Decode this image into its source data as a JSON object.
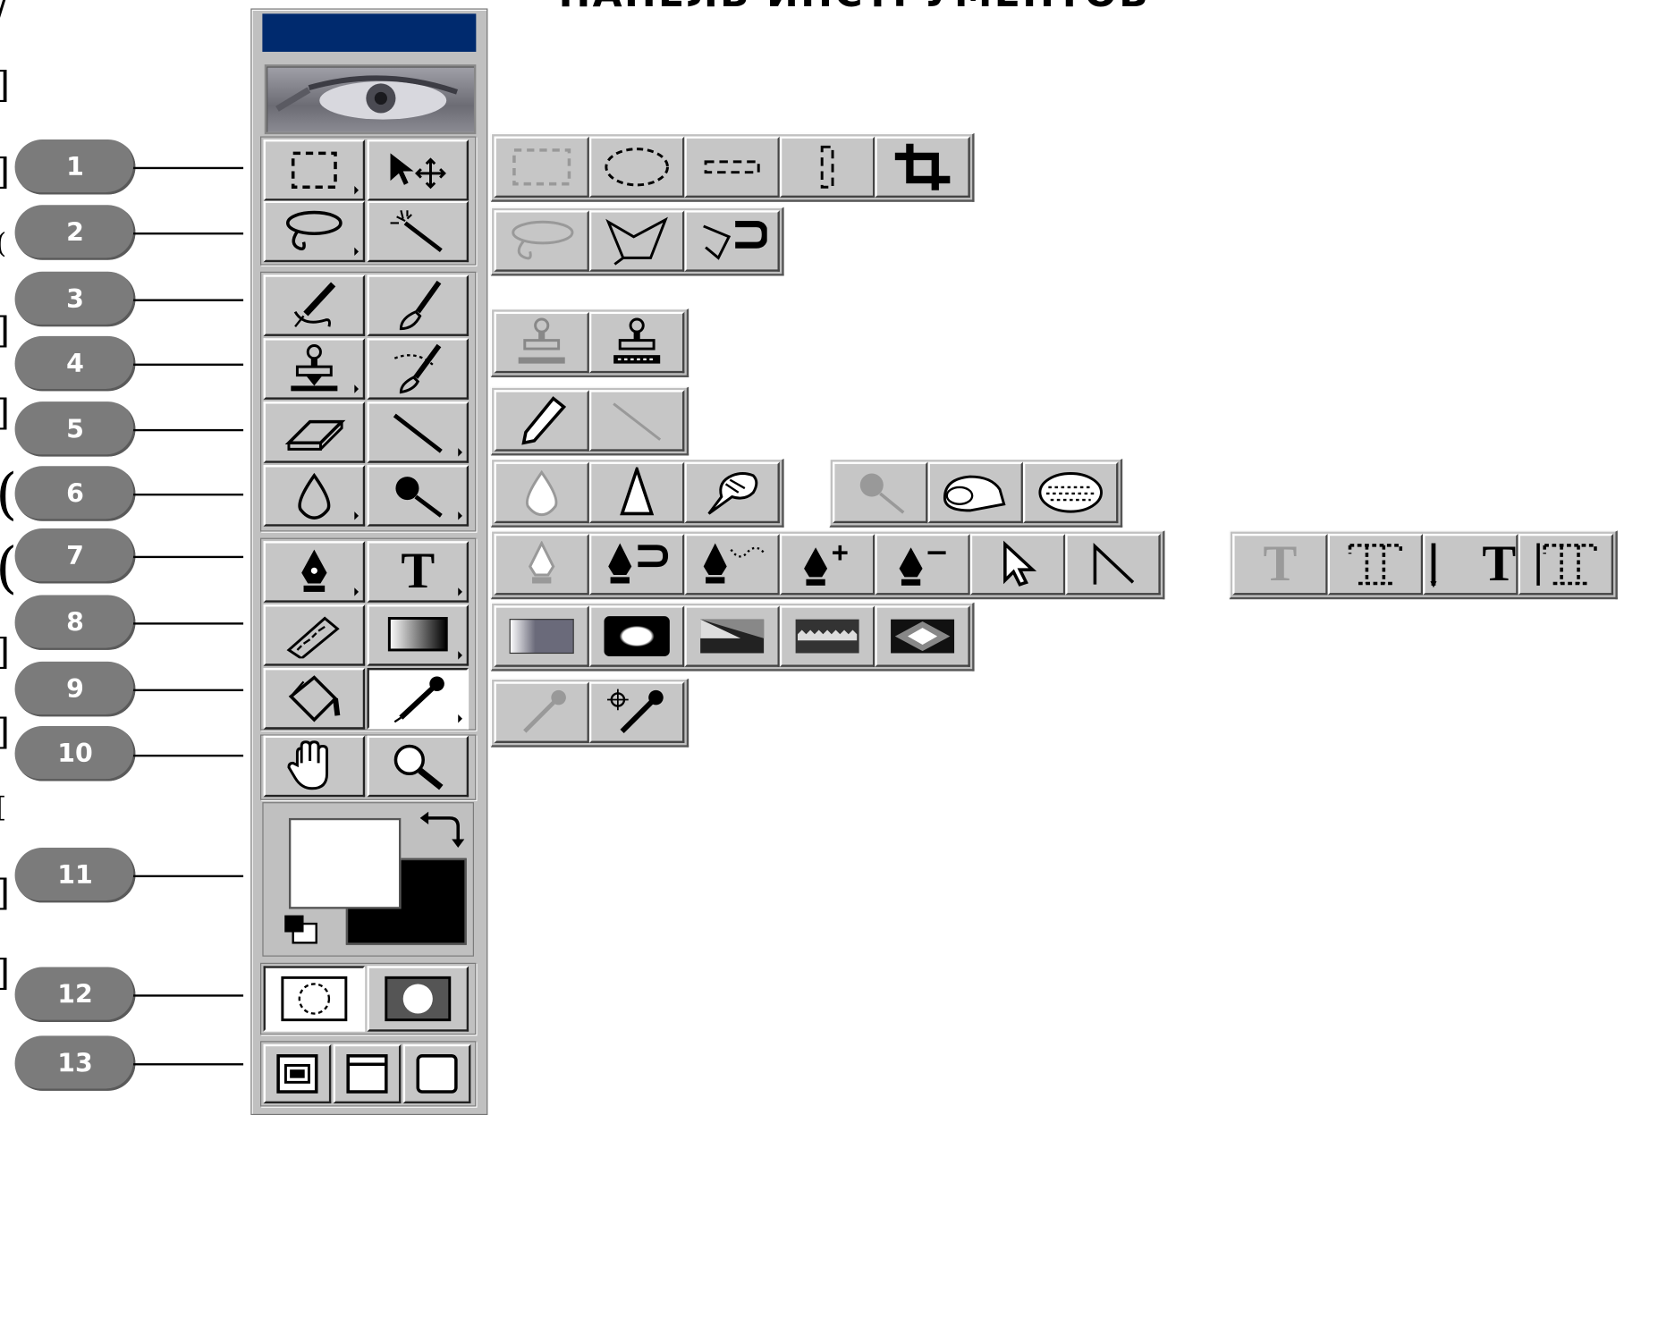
{
  "heading_fragment": "ПАНЕЛЬ ИНСТРУМЕНТОВ",
  "left_edge_glyphs": [
    "/",
    "]",
    "]",
    "(",
    "]",
    "]",
    "(",
    "(",
    "]",
    "]",
    "[",
    "]",
    "]"
  ],
  "callouts": [
    "1",
    "2",
    "3",
    "4",
    "5",
    "6",
    "7",
    "8",
    "9",
    "10",
    "11",
    "12",
    "13"
  ],
  "toolbox": {
    "tools": [
      {
        "row": 1,
        "left": "rect-marquee-icon",
        "right": "move-icon"
      },
      {
        "row": 2,
        "left": "lasso-icon",
        "right": "magic-wand-icon"
      },
      {
        "row": 3,
        "left": "airbrush-icon",
        "right": "paintbrush-icon"
      },
      {
        "row": 4,
        "left": "rubber-stamp-icon",
        "right": "history-brush-icon"
      },
      {
        "row": 5,
        "left": "eraser-icon",
        "right": "line-icon"
      },
      {
        "row": 6,
        "left": "blur-icon",
        "right": "dodge-icon"
      },
      {
        "row": 7,
        "left": "pen-icon",
        "right": "type-icon"
      },
      {
        "row": 8,
        "left": "measure-icon",
        "right": "gradient-icon"
      },
      {
        "row": 9,
        "left": "paint-bucket-icon",
        "right": "eyedropper-icon"
      },
      {
        "row": 10,
        "left": "hand-icon",
        "right": "zoom-icon"
      }
    ],
    "type_glyph": "T"
  },
  "flyouts": {
    "marquee": [
      "rect-marquee-icon",
      "ellipse-marquee-icon",
      "single-row-marquee-icon",
      "single-column-marquee-icon",
      "crop-icon"
    ],
    "lasso": [
      "lasso-icon",
      "polygon-lasso-icon",
      "magnetic-lasso-icon"
    ],
    "stamp": [
      "rubber-stamp-icon",
      "pattern-stamp-icon"
    ],
    "pencil": [
      "pencil-icon",
      "line-icon"
    ],
    "focus": [
      "blur-icon",
      "sharpen-icon",
      "smudge-icon"
    ],
    "toning": [
      "dodge-icon",
      "burn-icon",
      "sponge-icon"
    ],
    "pen": [
      "pen-icon",
      "magnetic-pen-icon",
      "freeform-pen-icon",
      "add-anchor-icon",
      "delete-anchor-icon",
      "direct-select-icon",
      "convert-point-icon"
    ],
    "type": [
      "T",
      "T",
      "T",
      "T"
    ],
    "gradient": [
      "linear-gradient-icon",
      "radial-gradient-icon",
      "angle-gradient-icon",
      "reflected-gradient-icon",
      "diamond-gradient-icon"
    ],
    "eyedropper": [
      "eyedropper-icon",
      "color-sampler-icon"
    ]
  },
  "colors": {
    "toolbox_bg": "#c0c0c0",
    "titlebar": "#002a6e",
    "badge": "#7b7b7b",
    "foreground": "#ffffff",
    "background": "#000000"
  }
}
